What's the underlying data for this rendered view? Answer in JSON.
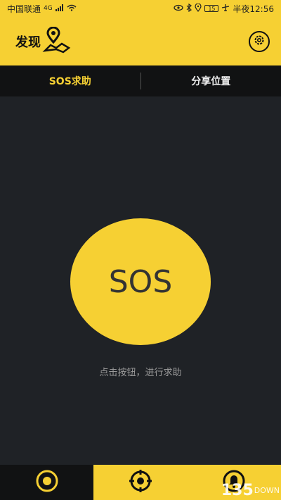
{
  "status_bar": {
    "carrier": "中国联通",
    "network": "4G",
    "battery": "15",
    "time": "半夜12:56",
    "icons": [
      "signal-icon",
      "wifi-icon",
      "eye-icon",
      "bluetooth-icon",
      "location-icon",
      "battery-icon",
      "airplane-icon"
    ]
  },
  "header": {
    "title": "发现",
    "logo_icon": "map-pin-icon",
    "settings_icon": "gear-icon"
  },
  "tabs": [
    {
      "label": "SOS求助",
      "active": true
    },
    {
      "label": "分享位置",
      "active": false
    }
  ],
  "sos": {
    "label": "SOS",
    "hint": "点击按钮，进行求助"
  },
  "bottom_nav": [
    {
      "icon": "discover-icon",
      "active": true
    },
    {
      "icon": "crosshair-icon",
      "active": false
    },
    {
      "icon": "bell-icon",
      "active": false
    }
  ],
  "watermark": {
    "number": "135",
    "text": "DOWN"
  },
  "colors": {
    "accent": "#f6d033",
    "background": "#1f2226",
    "dark": "#111213"
  }
}
